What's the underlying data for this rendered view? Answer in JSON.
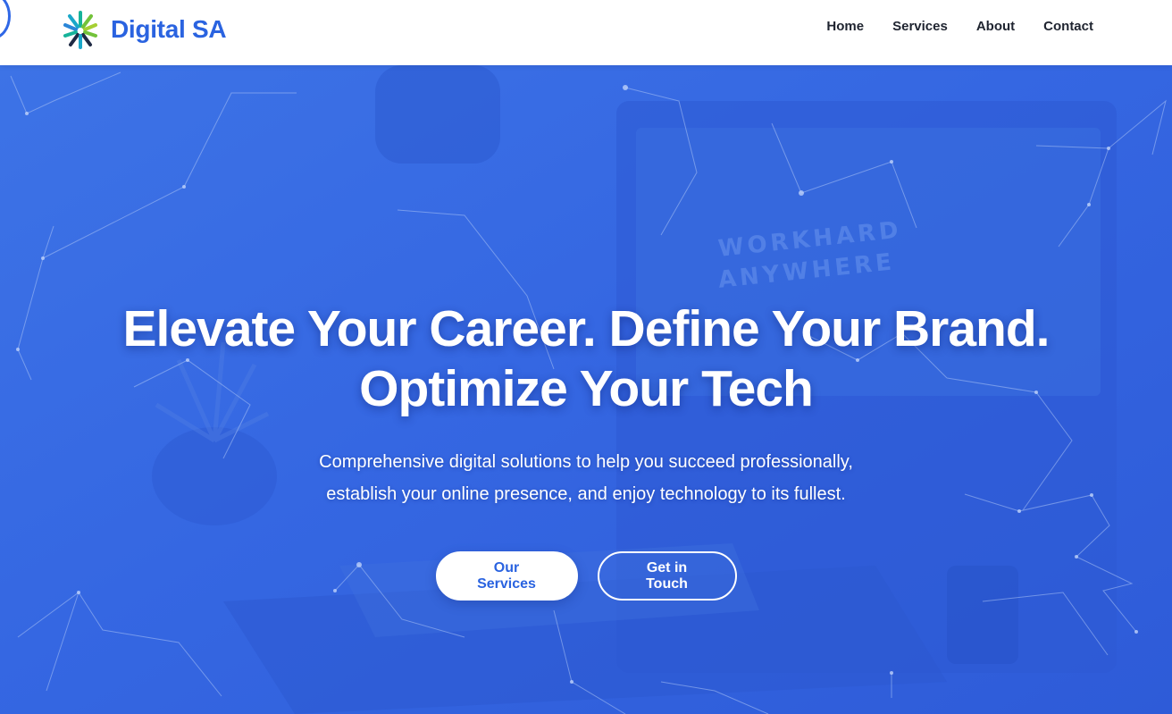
{
  "header": {
    "brand_name": "Digital SA",
    "logo_icon": "spark-burst-logo-icon",
    "nav": [
      {
        "label": "Home"
      },
      {
        "label": "Services"
      },
      {
        "label": "About"
      },
      {
        "label": "Contact"
      }
    ]
  },
  "hero": {
    "title_line1": "Elevate Your Career. Define Your Brand.",
    "title_line2": "Optimize Your Tech",
    "subtitle_line1": "Comprehensive digital solutions to help you succeed professionally,",
    "subtitle_line2": "establish your online presence, and enjoy technology to its fullest.",
    "primary_button": "Our Services",
    "secondary_button": "Get in Touch",
    "background": "blue-tinted-workspace-photo-with-network-lines",
    "monitor_text_line1": "WORKHARD",
    "monitor_text_line2": "ANYWHERE"
  },
  "colors": {
    "brand": "#2a63e0",
    "hero_overlay": "#3567e2",
    "nav_text": "#1f2430",
    "button_text_primary": "#2a63e0"
  }
}
